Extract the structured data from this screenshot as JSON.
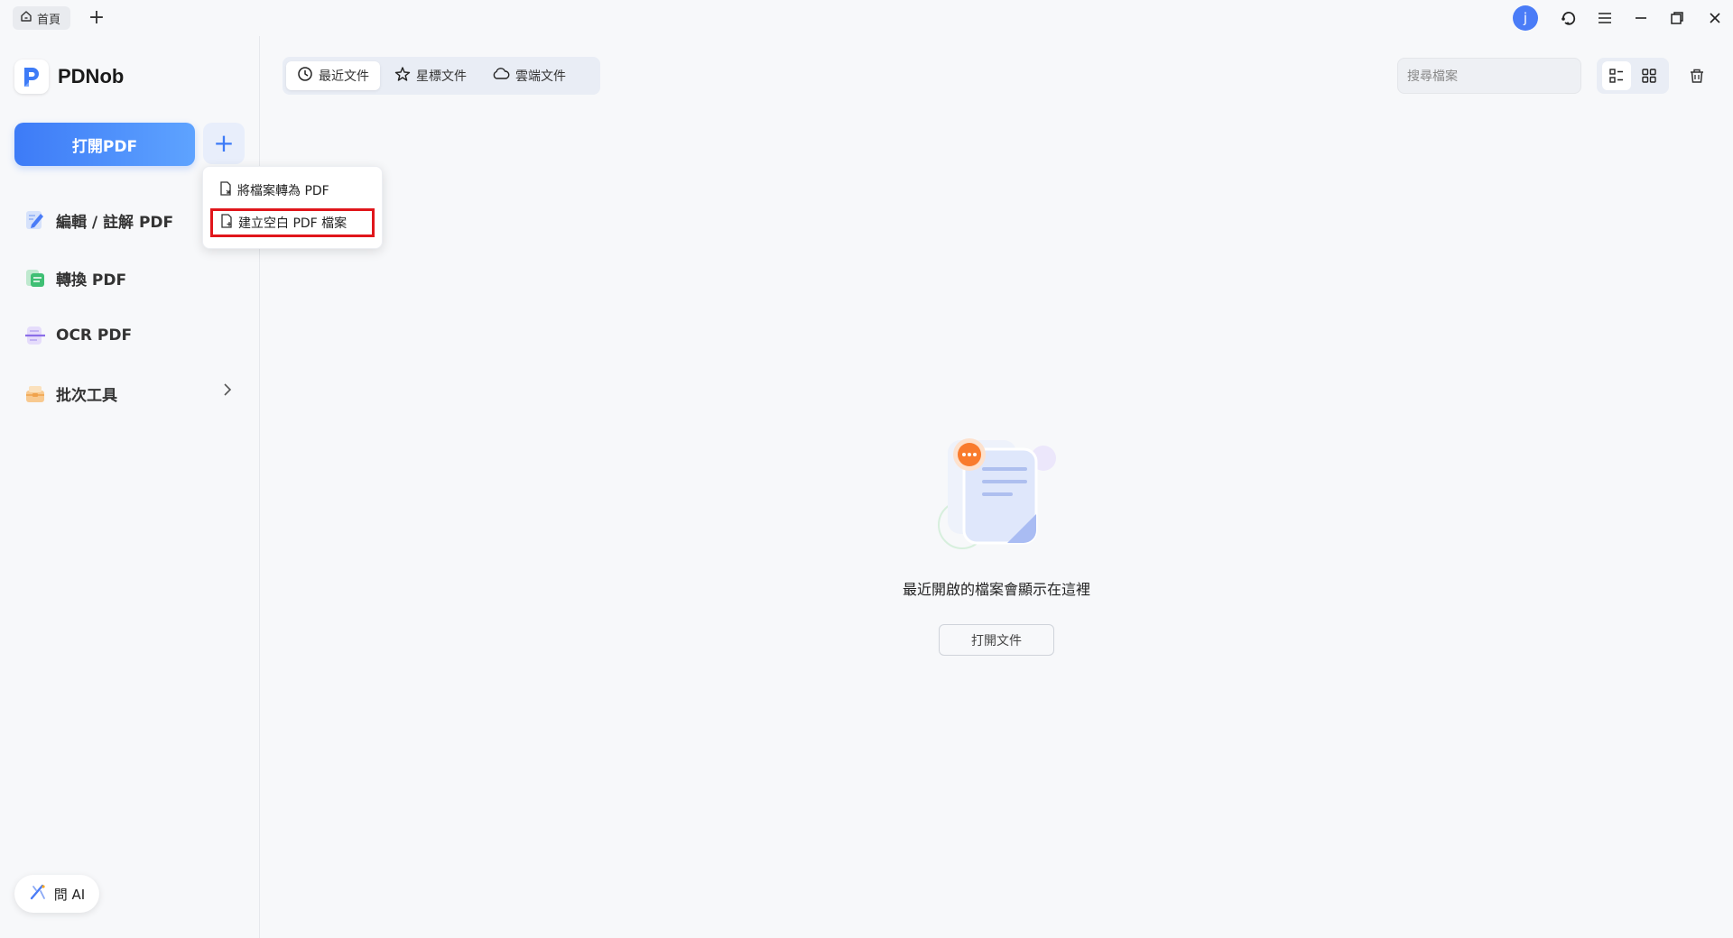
{
  "topbar": {
    "home_tab_label": "首頁",
    "new_tab_symbol": "+",
    "avatar_letter": "j"
  },
  "sidebar": {
    "brand_name": "PDNob",
    "open_pdf_label": "打開PDF",
    "plus_symbol": "+",
    "items": [
      {
        "label": "編輯 / 註解 PDF",
        "icon": "edit-icon"
      },
      {
        "label": "轉換 PDF",
        "icon": "convert-icon"
      },
      {
        "label": "OCR PDF",
        "icon": "ocr-icon"
      },
      {
        "label": "批次工具",
        "icon": "batch-icon"
      }
    ],
    "ask_ai_label": "問 AI"
  },
  "dropdown": {
    "items": [
      {
        "label": "將檔案轉為 PDF"
      },
      {
        "label": "建立空白 PDF 檔案"
      }
    ]
  },
  "main": {
    "tabs": [
      {
        "label": "最近文件",
        "icon": "clock-icon",
        "active": true
      },
      {
        "label": "星標文件",
        "icon": "star-icon",
        "active": false
      },
      {
        "label": "雲端文件",
        "icon": "cloud-icon",
        "active": false
      }
    ],
    "search_placeholder": "搜尋檔案",
    "empty_text": "最近開啟的檔案會顯示在這裡",
    "open_doc_label": "打開文件"
  },
  "colors": {
    "accent": "#3d7bf7",
    "highlight_border": "#e0161b",
    "badge_orange": "#f97b2d"
  }
}
